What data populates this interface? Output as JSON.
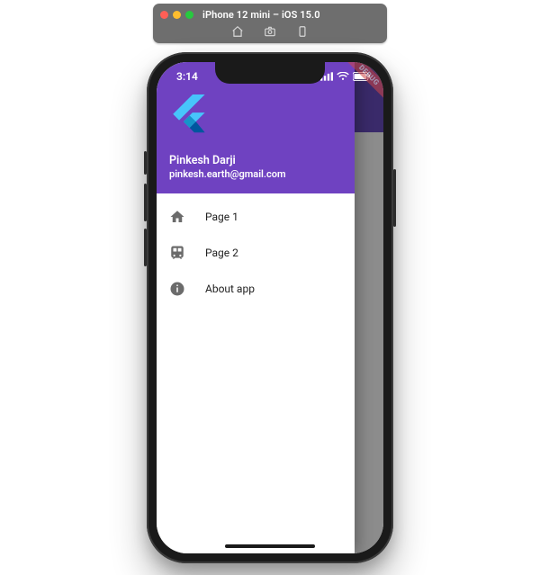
{
  "simulator": {
    "title": "iPhone 12 mini – iOS 15.0",
    "traffic": {
      "red": "#ff5f56",
      "yellow": "#ffbd2e",
      "green": "#27c93f"
    }
  },
  "status": {
    "time": "3:14"
  },
  "debug_banner": "DEBUG",
  "drawer": {
    "header": {
      "name": "Pinkesh Darji",
      "email": "pinkesh.earth@gmail.com"
    },
    "items": [
      {
        "icon": "home",
        "label": "Page 1"
      },
      {
        "icon": "train",
        "label": "Page 2"
      },
      {
        "icon": "info",
        "label": "About app"
      }
    ]
  },
  "colors": {
    "primary": "#6f42c1",
    "appbar_dim": "#3a2a6a",
    "scrim": "#8c8c8c"
  }
}
